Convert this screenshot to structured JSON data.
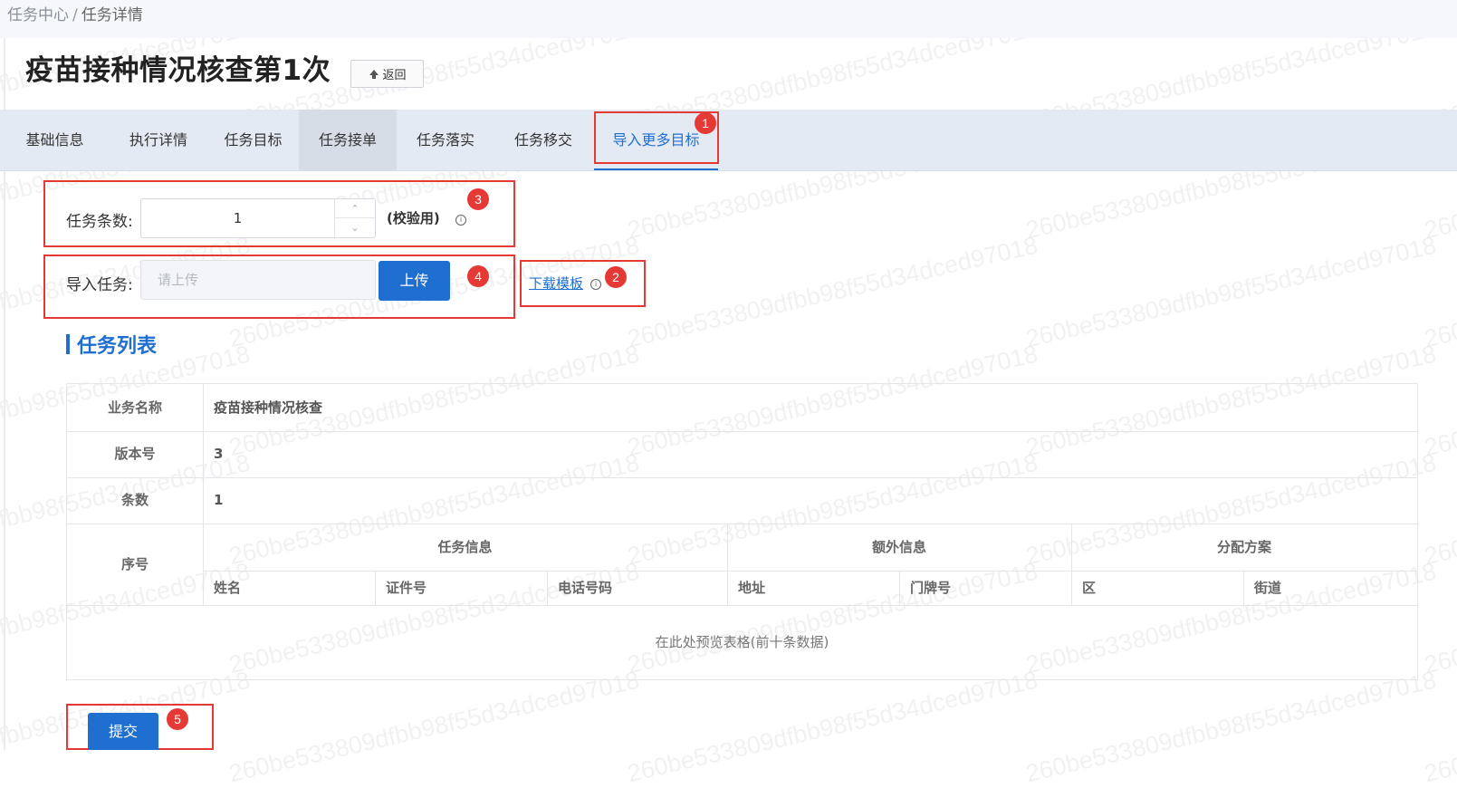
{
  "breadcrumb": {
    "root": "任务中心",
    "separator": "/",
    "current": "任务详情"
  },
  "page": {
    "title": "疫苗接种情况核查第1次",
    "back_label": "返回"
  },
  "tabs": [
    {
      "label": "基础信息"
    },
    {
      "label": "执行详情"
    },
    {
      "label": "任务目标"
    },
    {
      "label": "任务接单"
    },
    {
      "label": "任务落实"
    },
    {
      "label": "任务移交"
    },
    {
      "label": "导入更多目标"
    }
  ],
  "form": {
    "task_count_label": "任务条数:",
    "task_count_value": "1",
    "check_hint": "(校验用)",
    "import_label": "导入任务:",
    "import_placeholder": "请上传",
    "upload_label": "上传",
    "download_label": "下载模板"
  },
  "annotations": {
    "b1": "1",
    "b2": "2",
    "b3": "3",
    "b4": "4",
    "b5": "5"
  },
  "list": {
    "title": "任务列表",
    "rows": [
      {
        "label": "业务名称",
        "value": "疫苗接种情况核查"
      },
      {
        "label": "版本号",
        "value": "3"
      },
      {
        "label": "条数",
        "value": "1"
      }
    ],
    "seq_header": "序号",
    "groups": [
      {
        "label": "任务信息"
      },
      {
        "label": "额外信息"
      },
      {
        "label": "分配方案"
      }
    ],
    "columns": [
      {
        "label": "姓名"
      },
      {
        "label": "证件号"
      },
      {
        "label": "电话号码"
      },
      {
        "label": "地址"
      },
      {
        "label": "门牌号"
      },
      {
        "label": "区"
      },
      {
        "label": "街道"
      }
    ],
    "empty_text": "在此处预览表格(前十条数据)"
  },
  "submit_label": "提交",
  "watermark": "260be533809dfbb98f55d34dced97018"
}
